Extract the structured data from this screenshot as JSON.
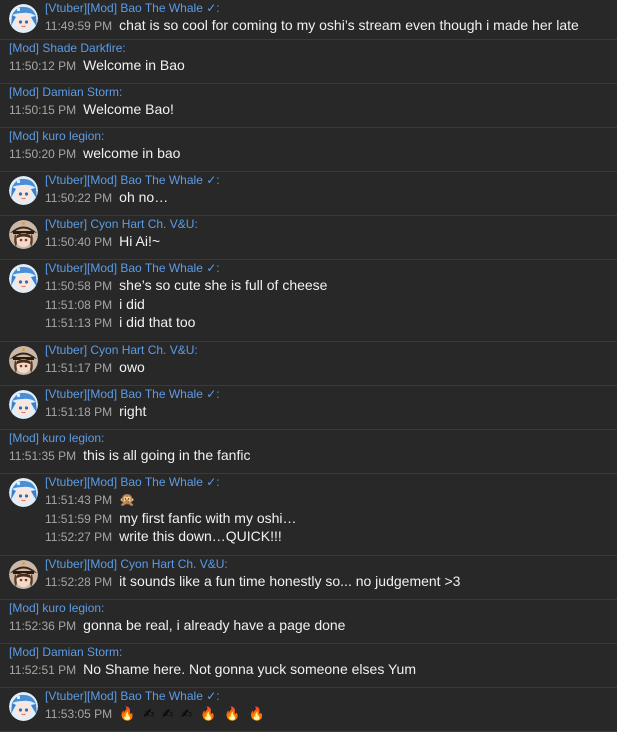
{
  "messages": [
    {
      "author": "[Vtuber][Mod] Bao The Whale ✓:",
      "avatar": "bao-avatar",
      "lines": [
        {
          "time": "11:49:59 PM",
          "text": "chat is so cool for coming to my oshi’s stream even though i made her late"
        }
      ]
    },
    {
      "author": "[Mod] Shade Darkfire:",
      "avatar": null,
      "lines": [
        {
          "time": "11:50:12 PM",
          "text": "Welcome in Bao"
        }
      ]
    },
    {
      "author": "[Mod] Damian Storm:",
      "avatar": null,
      "lines": [
        {
          "time": "11:50:15 PM",
          "text": "Welcome Bao!"
        }
      ]
    },
    {
      "author": "[Mod] kuro legion:",
      "avatar": null,
      "lines": [
        {
          "time": "11:50:20 PM",
          "text": "welcome in bao"
        }
      ]
    },
    {
      "author": "[Vtuber][Mod] Bao The Whale ✓:",
      "avatar": "bao-avatar",
      "lines": [
        {
          "time": "11:50:22 PM",
          "text": "oh no…"
        }
      ]
    },
    {
      "author": "[Vtuber] Cyon Hart Ch. V&U:",
      "avatar": "cyon-avatar",
      "lines": [
        {
          "time": "11:50:40 PM",
          "text": "Hi Ai!~"
        }
      ]
    },
    {
      "author": "[Vtuber][Mod] Bao The Whale ✓:",
      "avatar": "bao-avatar",
      "lines": [
        {
          "time": "11:50:58 PM",
          "text": "she’s so cute she is full of cheese"
        },
        {
          "time": "11:51:08 PM",
          "text": "i did"
        },
        {
          "time": "11:51:13 PM",
          "text": "i did that too"
        }
      ]
    },
    {
      "author": "[Vtuber] Cyon Hart Ch. V&U:",
      "avatar": "cyon-avatar",
      "lines": [
        {
          "time": "11:51:17 PM",
          "text": "owo"
        }
      ]
    },
    {
      "author": "[Vtuber][Mod] Bao The Whale ✓:",
      "avatar": "bao-avatar",
      "lines": [
        {
          "time": "11:51:18 PM",
          "text": "right"
        }
      ]
    },
    {
      "author": "[Mod] kuro legion:",
      "avatar": null,
      "lines": [
        {
          "time": "11:51:35 PM",
          "text": "this is all going in the fanfic"
        }
      ]
    },
    {
      "author": "[Vtuber][Mod] Bao The Whale ✓:",
      "avatar": "bao-avatar",
      "lines": [
        {
          "time": "11:51:43 PM",
          "text": "",
          "emojis": [
            "🙊"
          ]
        },
        {
          "time": "11:51:59 PM",
          "text": "my first fanfic with my oshi…"
        },
        {
          "time": "11:52:27 PM",
          "text": "write this down…QUICK!!!"
        }
      ]
    },
    {
      "author": "[Vtuber][Mod] Cyon Hart Ch. V&U:",
      "avatar": "cyon-avatar",
      "lines": [
        {
          "time": "11:52:28 PM",
          "text": "it sounds like a fun time honestly so... no judgement >3"
        }
      ]
    },
    {
      "author": "[Mod] kuro legion:",
      "avatar": null,
      "lines": [
        {
          "time": "11:52:36 PM",
          "text": "gonna be real, i already have a page done"
        }
      ]
    },
    {
      "author": "[Mod] Damian Storm:",
      "avatar": null,
      "lines": [
        {
          "time": "11:52:51 PM",
          "text": "No Shame here. Not gonna yuck someone elses Yum"
        }
      ]
    },
    {
      "author": "[Vtuber][Mod] Bao The Whale ✓:",
      "avatar": "bao-avatar",
      "lines": [
        {
          "time": "11:53:05 PM",
          "text": "",
          "emojis": [
            "🔥",
            "✍",
            "✍",
            "✍",
            "🔥",
            "🔥",
            "🔥"
          ]
        }
      ]
    }
  ]
}
